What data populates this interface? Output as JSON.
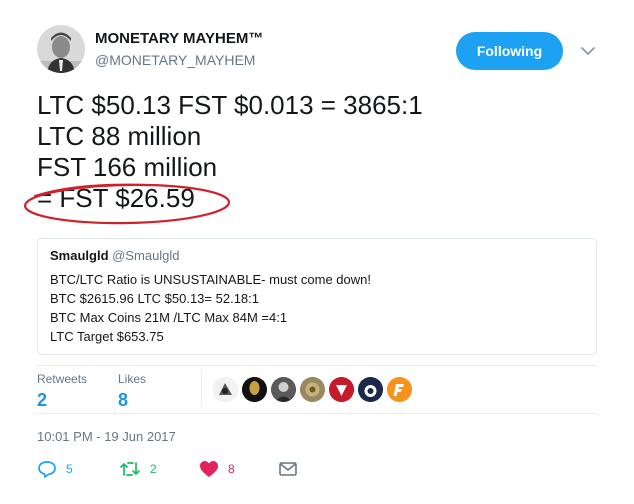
{
  "author": {
    "display_name": "MONETARY MAYHEM™",
    "handle": "@MONETARY_MAYHEM",
    "avatar_icon": "author-avatar"
  },
  "follow_button": {
    "label": "Following",
    "color": "#1da1f2"
  },
  "caret_icon": "chevron-down-icon",
  "tweet": {
    "lines": [
      "LTC $50.13 FST $0.013 = 3865:1",
      "LTC 88 million",
      "FST 166 million",
      "= FST $26.59"
    ],
    "highlight_color": "#d0202a"
  },
  "quote": {
    "name": "Smaulgld",
    "handle": "@Smaulgld",
    "lines": [
      "BTC/LTC Ratio is UNSUSTAINABLE- must come down!",
      "BTC $2615.96 LTC $50.13= 52.18:1",
      "BTC Max Coins 21M /LTC Max 84M =4:1",
      "LTC Target  $653.75"
    ]
  },
  "stats": {
    "retweets": {
      "label": "Retweets",
      "value": "2"
    },
    "likes": {
      "label": "Likes",
      "value": "8"
    }
  },
  "likers": [
    "avatar-1",
    "avatar-2",
    "avatar-3",
    "avatar-4",
    "avatar-5",
    "avatar-6",
    "avatar-7"
  ],
  "timestamp": "10:01 PM - 19 Jun 2017",
  "actions": {
    "reply": {
      "icon": "reply-icon",
      "count": "5",
      "color": "#1da1f2"
    },
    "retweet": {
      "icon": "retweet-icon",
      "count": "2",
      "color": "#17bf63"
    },
    "like": {
      "icon": "heart-icon",
      "count": "8",
      "color": "#e0245e"
    },
    "message": {
      "icon": "envelope-icon",
      "color": "#657786"
    }
  }
}
